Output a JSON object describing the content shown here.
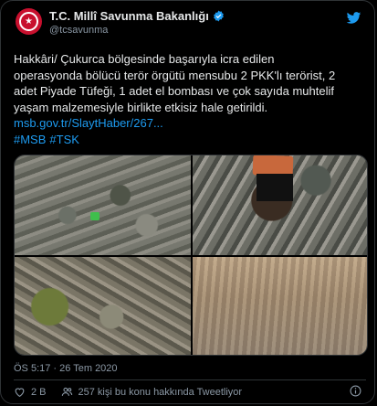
{
  "tweet": {
    "author_name": "T.C. Millî Savunma Bakanlığı",
    "handle": "@tcsavunma",
    "text_lines": [
      "Hakkâri/ Çukurca bölgesinde başarıyla icra edilen",
      "operasyonda bölücü terör örgütü mensubu 2 PKK'lı terörist, 2",
      "adet Piyade Tüfeği, 1 adet el bombası ve çok sayıda muhtelif",
      "yaşam malzemesiyle birlikte etkisiz hale getirildi."
    ],
    "link": "msb.gov.tr/SlaytHaber/267...",
    "hashtags": [
      "#MSB",
      "#TSK"
    ],
    "timestamp": "ÖS 5:17 · 26 Tem 2020",
    "likes": "2 B",
    "talking": "257 kişi bu konu hakkında Tweetliyor"
  },
  "icons": {
    "verified": "verified-badge-icon",
    "twitter": "twitter-bird-icon",
    "like": "heart-icon",
    "talking": "people-icon",
    "info": "info-icon"
  },
  "colors": {
    "accent": "#1d9bf0",
    "background": "#000000",
    "avatar": "#c8102e"
  }
}
